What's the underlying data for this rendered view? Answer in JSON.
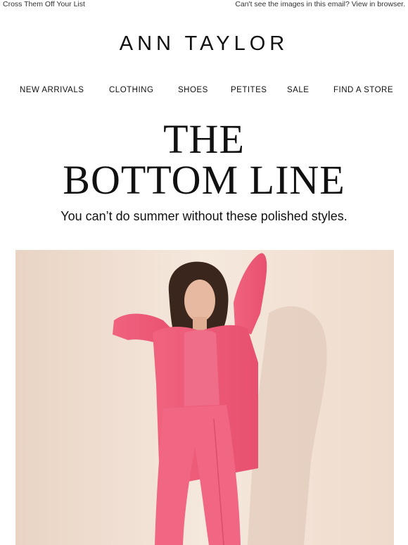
{
  "preheader": {
    "left_link": "Cross Them Off Your List",
    "right_link": "Can't see the images in this email? View in browser."
  },
  "brand": {
    "logo_text": "ANN TAYLOR"
  },
  "nav": {
    "items": [
      {
        "label": "NEW ARRIVALS"
      },
      {
        "label": "CLOTHING"
      },
      {
        "label": "SHOES"
      },
      {
        "label": "PETITES"
      },
      {
        "label": "SALE"
      },
      {
        "label": "FIND A STORE"
      }
    ]
  },
  "hero_text": {
    "line1": "THE",
    "line2": "BOTTOM LINE",
    "subhead": "You can’t do summer without these polished styles."
  },
  "colors": {
    "hero_background": "#f2e2d5",
    "outfit_pink": "#ee5a7e",
    "text": "#111111"
  }
}
